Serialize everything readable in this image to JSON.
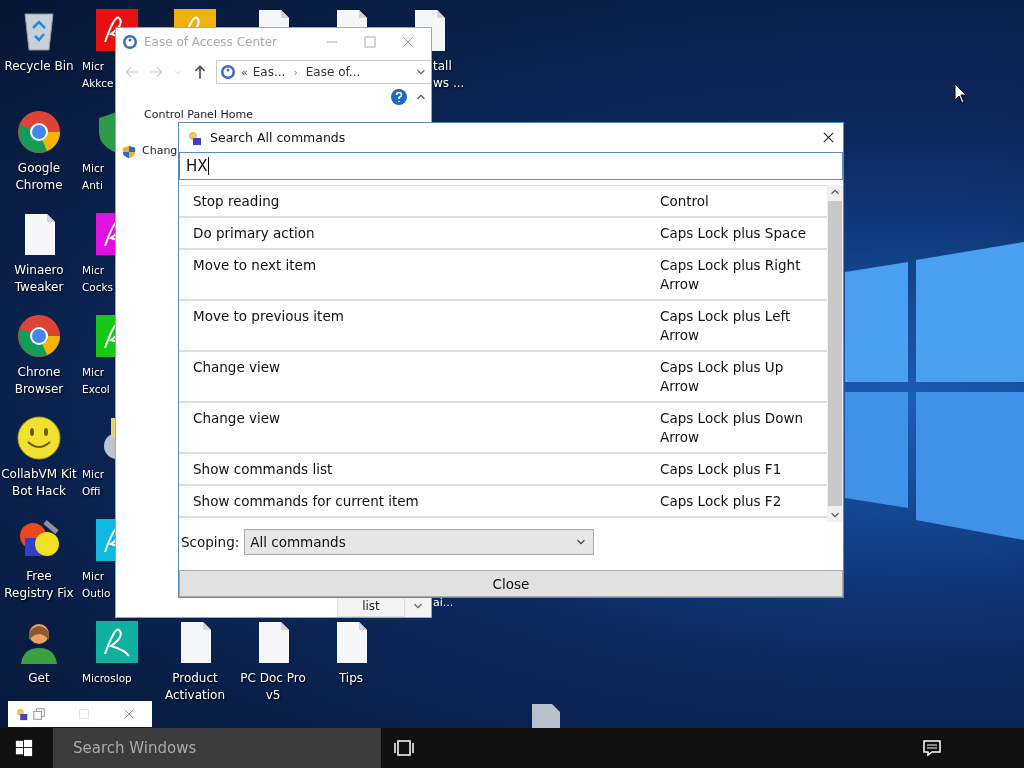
{
  "desktop_columns": [
    [
      {
        "kind": "recycle",
        "label": [
          "Recycle Bin"
        ]
      },
      {
        "kind": "chrome",
        "label": [
          "Google",
          "Chrome"
        ]
      },
      {
        "kind": "file",
        "label": [
          "Winaero",
          "Tweaker"
        ]
      },
      {
        "kind": "chrome",
        "label": [
          "Chrone",
          "Browser"
        ]
      },
      {
        "kind": "smiley",
        "label": [
          "CollabVM Kit",
          "Bot Hack"
        ]
      },
      {
        "kind": "registry",
        "label": [
          "Free",
          "Registry Fix"
        ]
      },
      {
        "kind": "person",
        "label": [
          "Get"
        ]
      }
    ],
    [
      {
        "kind": "tile",
        "color": "#e81010",
        "label": [
          "Micr",
          "Akkce"
        ]
      },
      {
        "kind": "shield",
        "label": [
          "Micr",
          "Anti"
        ]
      },
      {
        "kind": "tile",
        "color": "#e010e0",
        "label": [
          "Micr",
          "Cocks"
        ]
      },
      {
        "kind": "tile",
        "color": "#18c818",
        "label": [
          "Micr",
          "Excol"
        ]
      },
      {
        "kind": "disc",
        "label": [
          "Micr",
          "Offi"
        ]
      },
      {
        "kind": "tile",
        "color": "#10b8e0",
        "label": [
          "Micr",
          "Outlo"
        ]
      },
      {
        "kind": "tile",
        "color": "#10b0a0",
        "label": [
          "Microslop"
        ]
      }
    ],
    [
      {
        "kind": "tile",
        "color": "#f0b010"
      },
      {
        "kind": "file",
        "label": [
          "Product",
          "Activation"
        ]
      }
    ],
    [
      {
        "kind": "file"
      },
      {
        "kind": "file",
        "label": [
          "PC Doc Pro",
          "v5"
        ]
      }
    ],
    [
      {
        "kind": "file"
      },
      {
        "kind": "file",
        "label": [
          "Tips"
        ]
      }
    ],
    [
      {
        "kind": "file",
        "label": [
          "tall",
          "ws ..."
        ]
      }
    ]
  ],
  "stray_label": "ai...",
  "ease_window": {
    "title": "Ease of Access Center",
    "breadcrumb": {
      "overflow": "«",
      "separator": "›",
      "items": [
        "Eas...",
        "Ease of..."
      ]
    },
    "sidebar_links": [
      {
        "text": "Control Panel Home",
        "shield": false
      },
      {
        "text": "Chang",
        "shield": true
      }
    ],
    "bottom_button": "list"
  },
  "search_dialog": {
    "title": "Search All commands",
    "query": "HX",
    "rows": [
      {
        "name": "Stop reading",
        "shortcut": "Control"
      },
      {
        "name": "Do primary action",
        "shortcut": "Caps Lock plus Space"
      },
      {
        "name": "Move to next item",
        "shortcut": "Caps Lock plus Right Arrow"
      },
      {
        "name": "Move to previous item",
        "shortcut": "Caps Lock plus Left Arrow"
      },
      {
        "name": "Change view",
        "shortcut": "Caps Lock plus Up Arrow"
      },
      {
        "name": "Change view",
        "shortcut": "Caps Lock plus Down Arrow"
      },
      {
        "name": "Show commands list",
        "shortcut": "Caps Lock plus F1"
      },
      {
        "name": "Show commands for current item",
        "shortcut": "Caps Lock plus F2"
      }
    ],
    "scoping_label": "Scoping:",
    "scoping_value": "All commands",
    "close_button": "Close"
  },
  "taskbar": {
    "search_placeholder": "Search Windows"
  }
}
